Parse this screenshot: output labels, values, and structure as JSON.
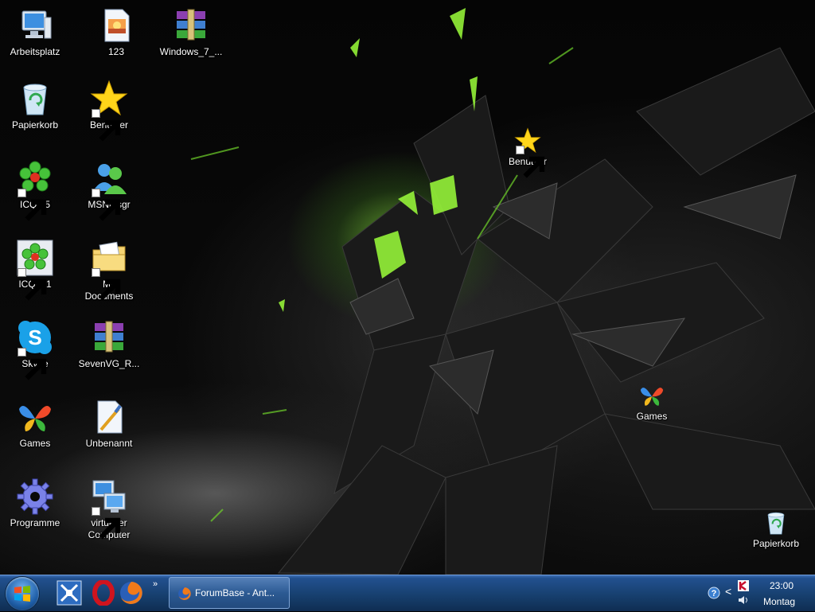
{
  "desktop": {
    "icons": [
      {
        "id": "arbeitsplatz",
        "label": "Arbeitsplatz",
        "icon": "computer-icon",
        "shortcut": false
      },
      {
        "id": "123",
        "label": "123",
        "icon": "image-file-icon",
        "shortcut": false
      },
      {
        "id": "windows7",
        "label": "Windows_7_...",
        "icon": "winrar-archive-icon",
        "shortcut": false
      },
      {
        "id": "papierkorb",
        "label": "Papierkorb",
        "icon": "recycle-bin-icon",
        "shortcut": false
      },
      {
        "id": "benutzer",
        "label": "Benutzer",
        "icon": "star-icon",
        "shortcut": true
      },
      {
        "id": "benutzer2",
        "label": "Benutzer",
        "icon": "star-icon",
        "shortcut": true
      },
      {
        "id": "icq65",
        "label": "ICQ6.5",
        "icon": "icq-flower-icon",
        "shortcut": true
      },
      {
        "id": "msnmsgr",
        "label": "MSNmsgr",
        "icon": "msn-messenger-icon",
        "shortcut": true
      },
      {
        "id": "icq51",
        "label": "ICQ 5.1",
        "icon": "icq-flower-icon",
        "shortcut": true
      },
      {
        "id": "mydocuments",
        "label": "My\nDocuments",
        "icon": "folder-icon",
        "shortcut": true
      },
      {
        "id": "skype",
        "label": "Skype",
        "icon": "skype-icon",
        "shortcut": true
      },
      {
        "id": "sevenvg",
        "label": "SevenVG_R...",
        "icon": "winrar-archive-icon",
        "shortcut": false
      },
      {
        "id": "games",
        "label": "Games",
        "icon": "games-butterfly-icon",
        "shortcut": false
      },
      {
        "id": "games2",
        "label": "Games",
        "icon": "games-butterfly-icon",
        "shortcut": false
      },
      {
        "id": "unbenannt",
        "label": "Unbenannt",
        "icon": "paint-image-icon",
        "shortcut": false
      },
      {
        "id": "programme",
        "label": "Programme",
        "icon": "gear-icon",
        "shortcut": false
      },
      {
        "id": "virtuellercomputer",
        "label": "virtueller\nComputer",
        "icon": "virtual-pc-icon",
        "shortcut": true
      },
      {
        "id": "papierkorb2",
        "label": "Papierkorb",
        "icon": "recycle-bin-icon",
        "shortcut": false
      }
    ]
  },
  "taskbar": {
    "start": {
      "icon": "windows-logo-icon"
    },
    "quicklaunch": [
      {
        "icon": "show-desktop-icon"
      },
      {
        "icon": "opera-icon"
      },
      {
        "icon": "firefox-icon"
      }
    ],
    "quicklaunch_more": "»",
    "tasks": [
      {
        "label": "ForumBase - Ant...",
        "icon": "firefox-icon"
      }
    ],
    "tray": {
      "expand": "<",
      "icons": [
        "help-icon",
        "kaspersky-icon",
        "volume-icon"
      ]
    },
    "clock": {
      "time": "23:00",
      "day": "Montag"
    }
  },
  "colors": {
    "taskbar_top": "#3c6fb5",
    "taskbar_bottom": "#0f2d52",
    "wallpaper_glow": "#8cff3c",
    "wallpaper_base": "#050505"
  }
}
